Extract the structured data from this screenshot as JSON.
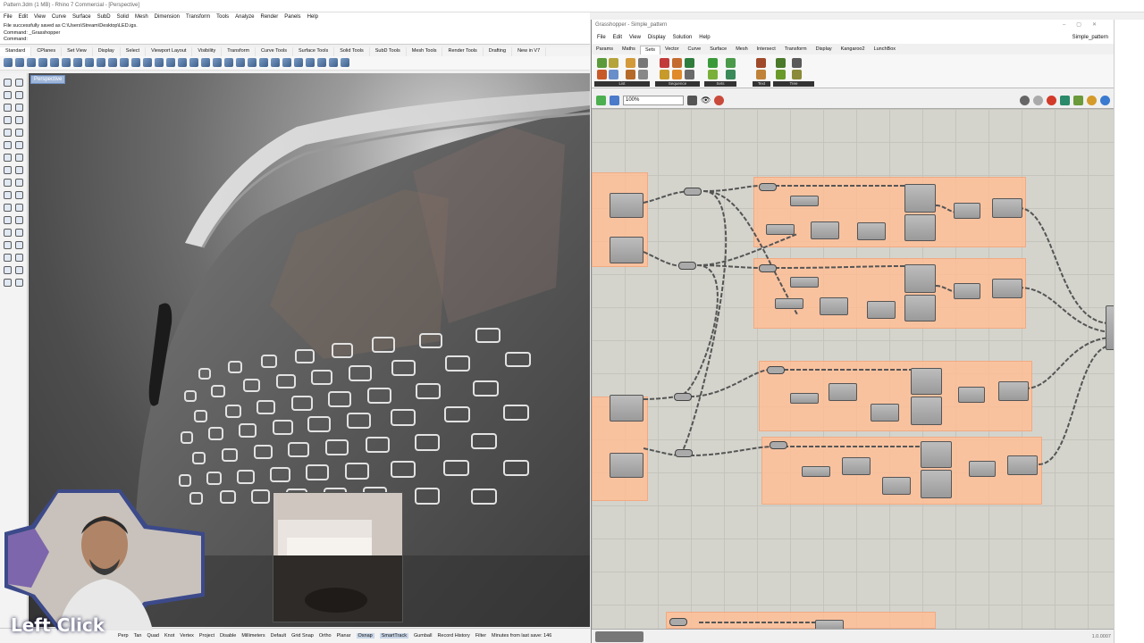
{
  "rhino": {
    "title": "Pattern.3dm (1 MB) - Rhino 7 Commercial - [Perspective]",
    "menu": [
      "File",
      "Edit",
      "View",
      "Curve",
      "Surface",
      "SubD",
      "Solid",
      "Mesh",
      "Dimension",
      "Transform",
      "Tools",
      "Analyze",
      "Render",
      "Panels",
      "Help"
    ],
    "command_history": [
      "File successfully saved as C:\\Users\\Stream\\Desktop\\LED.igs.",
      "Command: _Grasshopper",
      "Command:"
    ],
    "toolbar_tabs": [
      "Standard",
      "CPlanes",
      "Set View",
      "Display",
      "Select",
      "Viewport Layout",
      "Visibility",
      "Transform",
      "Curve Tools",
      "Surface Tools",
      "Solid Tools",
      "SubD Tools",
      "Mesh Tools",
      "Render Tools",
      "Drafting",
      "New in V7"
    ],
    "viewport_label": "Perspective",
    "status_checks": [
      "Perp",
      "Tan",
      "Quad",
      "Knot",
      "Vertex",
      "Project",
      "Disable"
    ],
    "status_units": "Millimeters",
    "status_layer": "Default",
    "status_toggles": [
      "Grid Snap",
      "Ortho",
      "Planar",
      "Osnap",
      "SmartTrack",
      "Gumball",
      "Record History",
      "Filter"
    ],
    "status_save": "Minutes from last save: 146"
  },
  "grasshopper": {
    "title": "Grasshopper - Simple_pattern",
    "menu": [
      "File",
      "Edit",
      "View",
      "Display",
      "Solution",
      "Help"
    ],
    "document_name": "Simple_pattern",
    "tabs": [
      "Params",
      "Maths",
      "Sets",
      "Vector",
      "Curve",
      "Surface",
      "Mesh",
      "Intersect",
      "Transform",
      "Display",
      "Kangaroo2",
      "LunchBox"
    ],
    "active_tab": "Sets",
    "ribbon_groups": [
      "List",
      "Sequence",
      "Sets",
      "Text",
      "Tree"
    ],
    "zoom": "100%",
    "version": "1.0.0007"
  },
  "overlay": {
    "caption": "Left Click"
  },
  "colors": {
    "cluster": "#ffbe96",
    "canvas": "#d4d4cd",
    "viewport_label": "#9fb6d9",
    "caption": "#ffffff"
  }
}
